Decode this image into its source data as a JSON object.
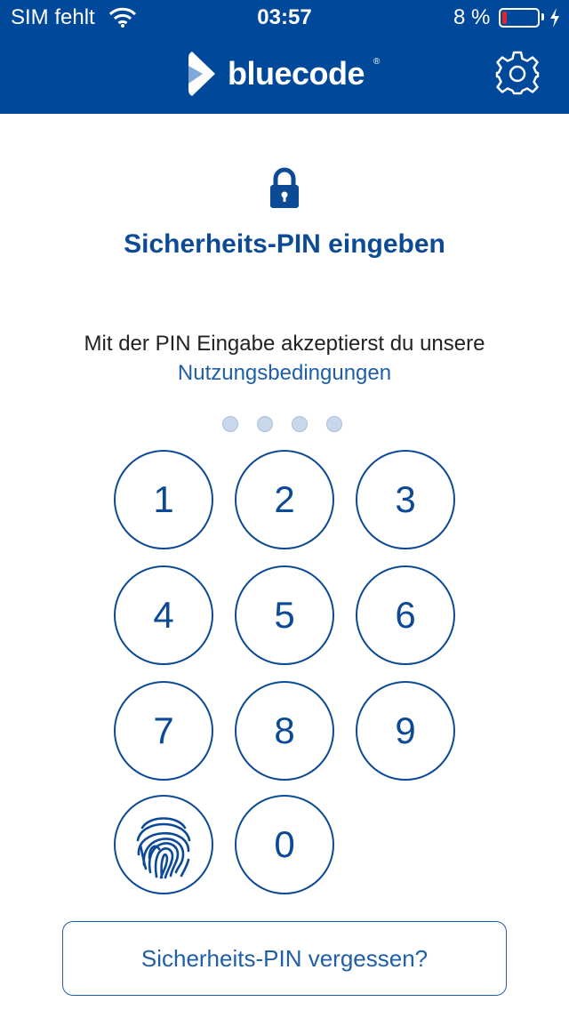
{
  "status_bar": {
    "carrier": "SIM fehlt",
    "time": "03:57",
    "battery_percent": "8 %",
    "battery_level": 0.08,
    "battery_color": "#e4262a",
    "icons": [
      "wifi-icon",
      "battery-icon",
      "charging-bolt-icon"
    ]
  },
  "header": {
    "brand_name": "bluecode",
    "brand_registered": "®",
    "background": "#004899",
    "icons": [
      "bluecode-logo-icon",
      "gear-icon"
    ]
  },
  "main": {
    "lock_icon": "lock-icon",
    "title": "Sicherheits-PIN eingeben",
    "consent_text": "Mit der PIN Eingabe akzeptierst du unsere",
    "terms_link": "Nutzungsbedingungen",
    "pin_length": 4,
    "pin_entered": 0
  },
  "keypad": {
    "keys": [
      "1",
      "2",
      "3",
      "4",
      "5",
      "6",
      "7",
      "8",
      "9",
      "0"
    ],
    "biometric_icon": "fingerprint-icon"
  },
  "forgot_button": "Sicherheits-PIN vergessen?",
  "colors": {
    "primary": "#0d4a96",
    "link": "#1f5ea8",
    "dot": "#c8d7ea"
  }
}
